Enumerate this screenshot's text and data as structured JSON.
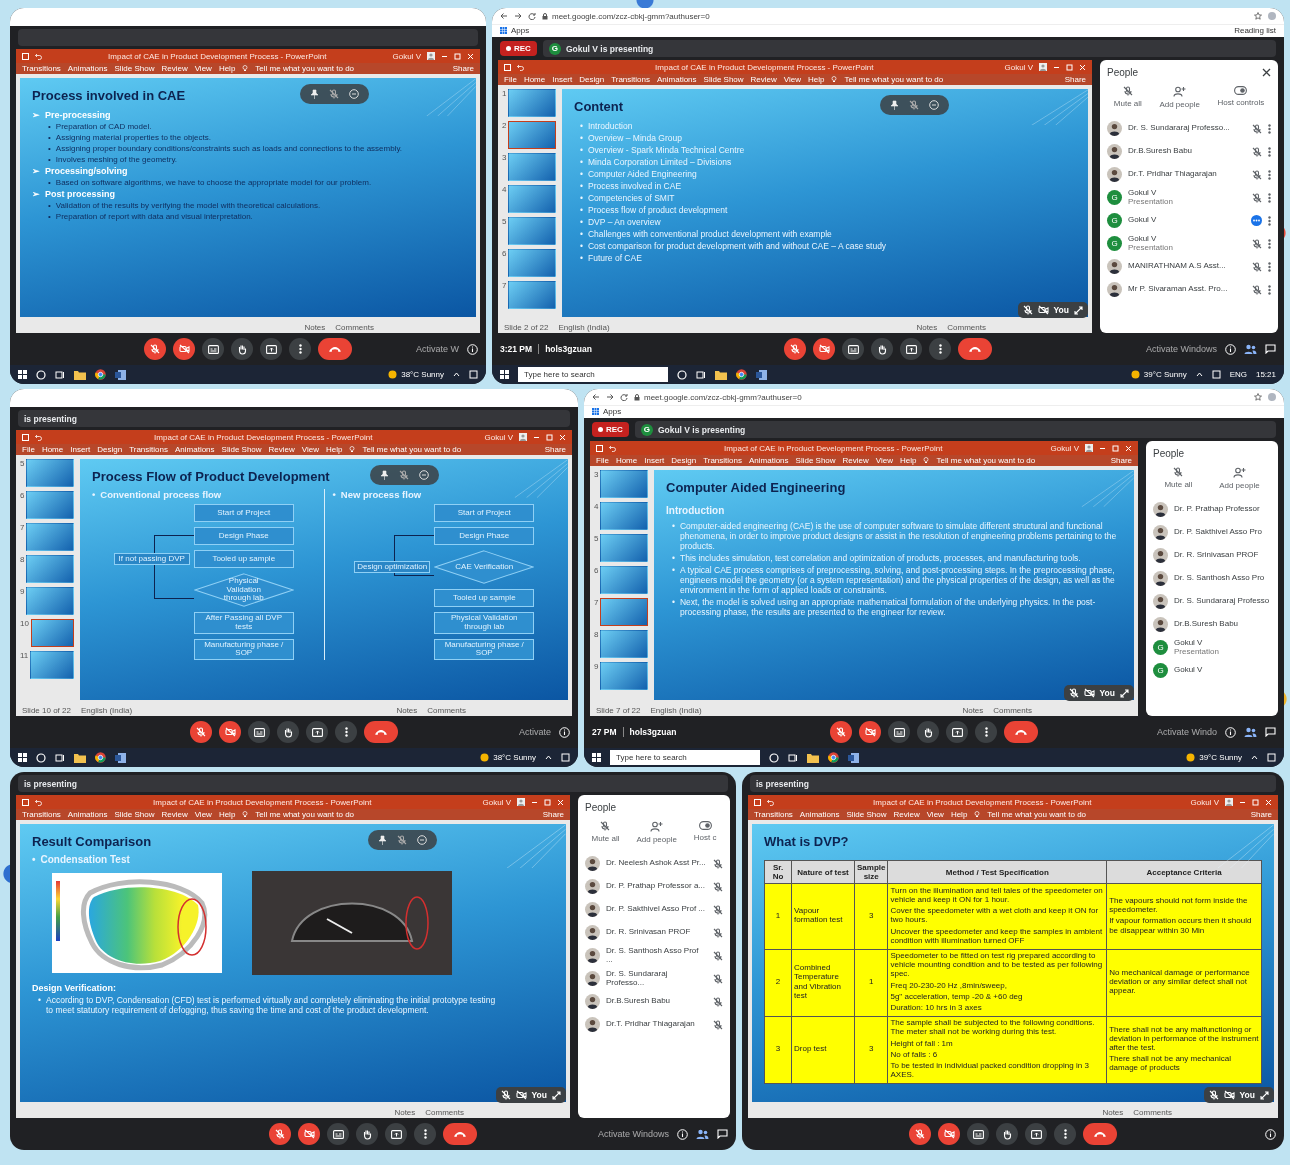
{
  "rows": [
    {
      "panels": [
        {
          "browser": {
            "kind": "blank"
          },
          "ppt": {
            "title": "Impact of CAE in Product Development Process - PowerPoint",
            "user": "Gokul V",
            "tabs": [
              "Transitions",
              "Animations",
              "Slide Show",
              "Review",
              "View",
              "Help"
            ],
            "tell_me": "Tell me what you want to do",
            "share": "Share",
            "status_right": [
              "Notes",
              "Comments"
            ]
          },
          "slide": {
            "kind": "bullets",
            "marker": "➢",
            "sub_marker": "•",
            "title": "Process involved in CAE",
            "items": [
              {
                "text": "Pre-processing",
                "children": [
                  {
                    "text": "Preparation of CAD model."
                  },
                  {
                    "text": "Assigning material properties to the objects."
                  },
                  {
                    "text": "Assigning proper boundary conditions/constraints such as loads and connections to the assembly."
                  },
                  {
                    "text": "Involves meshing of the geometry."
                  }
                ]
              },
              {
                "text": "Processing/solving",
                "children": [
                  {
                    "text": "Based on software algorithms, we have to choose the appropriate model for our problem."
                  }
                ]
              },
              {
                "text": "Post processing",
                "children": [
                  {
                    "text": "Validation of the results by verifying the model with theoretical calculations."
                  },
                  {
                    "text": "Preparation of report with data and visual interpretation."
                  }
                ]
              }
            ]
          },
          "presenter_pill": true,
          "controls": {
            "mic_on": false,
            "camera_on": false
          },
          "activate": "Activate W",
          "taskbar": {
            "weather": "38°C Sunny"
          }
        },
        {
          "browser": {
            "kind": "full",
            "url": "meet.google.com/zcz-cbkj-gmm?authuser=0",
            "apps": "Apps",
            "reading_list": "Reading list"
          },
          "rec": "REC",
          "presenter_initial": "G",
          "presenting": "Gokul V is presenting",
          "ppt": {
            "title": "Impact of CAE in Product Development Process - PowerPoint",
            "user": "Gokul V",
            "tabs": [
              "File",
              "Home",
              "Insert",
              "Design",
              "Transitions",
              "Animations",
              "Slide Show",
              "Review",
              "View",
              "Help"
            ],
            "tell_me": "Tell me what you want to do",
            "share": "Share",
            "thumbs": [
              {
                "number": "1",
                "selected": false
              },
              {
                "number": "2",
                "selected": true
              },
              {
                "number": "3",
                "selected": false
              },
              {
                "number": "4",
                "selected": false
              },
              {
                "number": "5",
                "selected": false
              },
              {
                "number": "6",
                "selected": false
              },
              {
                "number": "7",
                "selected": false
              }
            ],
            "status_left": [
              "Slide 2 of 22",
              "English (India)"
            ],
            "status_right": [
              "Notes",
              "Comments"
            ]
          },
          "slide": {
            "kind": "bullets",
            "marker": "•",
            "title": "Content",
            "items": [
              {
                "text": "Introduction"
              },
              {
                "text": "Overview – Minda Group"
              },
              {
                "text": "Overview - Spark Minda Technical Centre"
              },
              {
                "text": "Minda Corporation Limited – Divisions"
              },
              {
                "text": "Computer Aided Engineering"
              },
              {
                "text": "Process involved in CAE"
              },
              {
                "text": "Competencies of SMIT"
              },
              {
                "text": "Process flow of product development"
              },
              {
                "text": "DVP – An overview"
              },
              {
                "text": "Challenges with conventional product development with example"
              },
              {
                "text": "Cost comparison for product development with and without CAE – A case study"
              },
              {
                "text": "Future of CAE"
              }
            ]
          },
          "presenter_pill": true,
          "self_view": {
            "label": "You"
          },
          "people": {
            "title": "People",
            "closable": true,
            "menu": true,
            "actions": [
              {
                "kind": "mute",
                "label": "Mute all"
              },
              {
                "kind": "add",
                "label": "Add people"
              },
              {
                "kind": "host",
                "label": "Host controls"
              }
            ],
            "items": [
              {
                "kind": "photo",
                "name": "Dr. S. Sundararaj Professo...",
                "muted": true,
                "speaking": false
              },
              {
                "kind": "photo",
                "name": "Dr.B.Suresh Babu",
                "muted": true,
                "speaking": false
              },
              {
                "kind": "photo",
                "name": "Dr.T. Pridhar Thiagarajan",
                "muted": true,
                "speaking": false
              },
              {
                "kind": "letter",
                "initial": "G",
                "name": "Gokul V",
                "note": "Presentation",
                "muted": true,
                "speaking": false
              },
              {
                "kind": "letter",
                "initial": "G",
                "name": "Gokul V",
                "muted": false,
                "speaking": true
              },
              {
                "kind": "letter",
                "initial": "G",
                "name": "Gokul V",
                "note": "Presentation",
                "muted": true,
                "speaking": false
              },
              {
                "kind": "photo",
                "name": "MANIRATHNAM A.S Asst...",
                "muted": true,
                "speaking": false
              },
              {
                "kind": "photo",
                "name": "Mr P. Sivaraman Asst. Pro...",
                "muted": true,
                "speaking": false
              }
            ]
          },
          "clock": "3:21 PM",
          "code": "hols3gzuan",
          "controls": {
            "mic_on": false,
            "camera_on": false
          },
          "activate": "Activate Windows",
          "taskbar": {
            "placeholder": "Type here to search",
            "weather": "39°C Sunny",
            "lang": "ENG",
            "time": "15:21"
          }
        }
      ]
    },
    {
      "panels": [
        {
          "browser": {
            "kind": "blank"
          },
          "presenting": "is presenting",
          "ppt": {
            "title": "Impact of CAE in Product Development Process - PowerPoint",
            "user": "Gokul V",
            "tabs": [
              "File",
              "Home",
              "Insert",
              "Design",
              "Transitions",
              "Animations",
              "Slide Show",
              "Review",
              "View",
              "Help"
            ],
            "tell_me": "Tell me what you want to do",
            "share": "Share",
            "thumbs": [
              {
                "number": "5",
                "selected": false
              },
              {
                "number": "6",
                "selected": false
              },
              {
                "number": "7",
                "selected": false
              },
              {
                "number": "8",
                "selected": false
              },
              {
                "number": "9",
                "selected": false
              },
              {
                "number": "10",
                "selected": true
              },
              {
                "number": "11",
                "selected": false
              }
            ],
            "status_left": [
              "Slide 10 of 22",
              "English (India)"
            ],
            "status_right": [
              "Notes",
              "Comments"
            ]
          },
          "slide": {
            "kind": "flow",
            "marker": "•",
            "title": "Process Flow of Product Development",
            "columns": [
              {
                "heading": "Conventional process flow",
                "side": "If not passing DVP",
                "nodes": [
                  {
                    "kind": "box",
                    "text": "Start of Project"
                  },
                  {
                    "kind": "box",
                    "text": "Design Phase"
                  },
                  {
                    "kind": "box",
                    "text": "Tooled up sample"
                  },
                  {
                    "kind": "decision",
                    "text": "Physical Validation through lab"
                  },
                  {
                    "kind": "box",
                    "text": "After Passing all DVP tests"
                  },
                  {
                    "kind": "box",
                    "text": "Manufacturing phase / SOP"
                  }
                ]
              },
              {
                "heading": "New process flow",
                "side": "Design optimization",
                "nodes": [
                  {
                    "kind": "box",
                    "text": "Start of Project"
                  },
                  {
                    "kind": "box",
                    "text": "Design Phase"
                  },
                  {
                    "kind": "decision",
                    "text": "CAE Verification"
                  },
                  {
                    "kind": "box",
                    "text": "Tooled up sample"
                  },
                  {
                    "kind": "box",
                    "text": "Physical Validation through lab"
                  },
                  {
                    "kind": "box",
                    "text": "Manufacturing phase / SOP"
                  }
                ]
              }
            ]
          },
          "presenter_pill": true,
          "controls": {
            "mic_on": false,
            "camera_on": false
          },
          "activate": "Activate",
          "taskbar": {
            "weather": "38°C Sunny"
          }
        },
        {
          "browser": {
            "kind": "full",
            "url": "meet.google.com/zcz-cbkj-gmm?authuser=0",
            "apps": "Apps"
          },
          "rec": "REC",
          "presenter_initial": "G",
          "presenting": "Gokul V is presenting",
          "ppt": {
            "title": "Impact of CAE in Product Development Process - PowerPoint",
            "user": "Gokul V",
            "tabs": [
              "File",
              "Home",
              "Insert",
              "Design",
              "Transitions",
              "Animations",
              "Slide Show",
              "Review",
              "View",
              "Help"
            ],
            "tell_me": "Tell me what you want to do",
            "share": "Share",
            "thumbs": [
              {
                "number": "3",
                "selected": false
              },
              {
                "number": "4",
                "selected": false
              },
              {
                "number": "5",
                "selected": false
              },
              {
                "number": "6",
                "selected": false
              },
              {
                "number": "7",
                "selected": true
              },
              {
                "number": "8",
                "selected": false
              },
              {
                "number": "9",
                "selected": false
              }
            ],
            "status_left": [
              "Slide 7 of 22",
              "English (India)"
            ],
            "status_right": [
              "Notes",
              "Comments"
            ]
          },
          "slide": {
            "kind": "bullets",
            "marker": "•",
            "title": "Computer Aided Engineering",
            "subtitle": "Introduction",
            "items": [
              {
                "text": "Computer-aided engineering (CAE) is the use of computer software to simulate different structural and functional phenomena, in order to improve product designs or assist in the resolution of engineering problems pertaining to the products."
              },
              {
                "text": "This includes simulation, test correlation and optimization of products, processes, and manufacturing tools."
              },
              {
                "text": "A typical CAE process comprises of preprocessing, solving, and post-processing steps. In the preprocessing phase, engineers model the geometry (or a system representation) and the physical properties of the design, as well as the environment in the form of applied loads or constraints."
              },
              {
                "text": "Next, the model is solved using an appropriate mathematical formulation of the underlying physics. In the post-processing phase, the results are presented to the engineer for review."
              }
            ]
          },
          "self_view": {
            "label": "You"
          },
          "people": {
            "title": "People",
            "actions": [
              {
                "kind": "mute",
                "label": "Mute all"
              },
              {
                "kind": "add",
                "label": "Add people"
              }
            ],
            "items": [
              {
                "kind": "photo",
                "name": "Dr. P. Prathap Professor"
              },
              {
                "kind": "photo",
                "name": "Dr. P. Sakthivel Asso Pro"
              },
              {
                "kind": "photo",
                "name": "Dr. R. Srinivasan PROF"
              },
              {
                "kind": "photo",
                "name": "Dr. S. Santhosh Asso Pro"
              },
              {
                "kind": "photo",
                "name": "Dr. S. Sundararaj Professo"
              },
              {
                "kind": "photo",
                "name": "Dr.B.Suresh Babu"
              },
              {
                "kind": "letter",
                "initial": "G",
                "name": "Gokul V",
                "note": "Presentation"
              },
              {
                "kind": "letter",
                "initial": "G",
                "name": "Gokul V"
              }
            ]
          },
          "clock": "27 PM",
          "code": "hols3gzuan",
          "controls": {
            "mic_on": false,
            "camera_on": false
          },
          "activate": "Activate Windo",
          "taskbar": {
            "placeholder": "Type here to search",
            "weather": "39°C Sunny"
          }
        }
      ]
    },
    {
      "panels": [
        {
          "presenting": "is presenting",
          "ppt": {
            "title": "Impact of CAE in Product Development Process - PowerPoint",
            "user": "Gokul V",
            "tabs": [
              "Transitions",
              "Animations",
              "Slide Show",
              "Review",
              "View",
              "Help"
            ],
            "tell_me": "Tell me what you want to do",
            "share": "Share",
            "status_right": [
              "Notes",
              "Comments"
            ]
          },
          "slide": {
            "kind": "result",
            "marker": "•",
            "title": "Result Comparison",
            "subheading": "Condensation Test",
            "verification_title": "Design Verification:",
            "verification_text": "According to DVP, Condensation (CFD) test is performed virtually and completely eliminating the initial prototype testing to meet statutory requirement of defogging, thus saving the time and cost of the product development."
          },
          "presenter_pill": true,
          "self_view": {
            "label": "You"
          },
          "people": {
            "title": "People",
            "actions": [
              {
                "kind": "mute",
                "label": "Mute all"
              },
              {
                "kind": "add",
                "label": "Add people"
              },
              {
                "kind": "host",
                "label": "Host c"
              }
            ],
            "items": [
              {
                "kind": "photo",
                "name": "Dr. Neelesh Ashok Asst Pr...",
                "muted": true,
                "speaking": false
              },
              {
                "kind": "photo",
                "name": "Dr. P. Prathap Professor a...",
                "muted": true,
                "speaking": false
              },
              {
                "kind": "photo",
                "name": "Dr. P. Sakthivel Asso Prof ...",
                "muted": true,
                "speaking": false
              },
              {
                "kind": "photo",
                "name": "Dr. R. Srinivasan PROF",
                "muted": true,
                "speaking": false
              },
              {
                "kind": "photo",
                "name": "Dr. S. Santhosh Asso Prof ...",
                "muted": true,
                "speaking": false
              },
              {
                "kind": "photo",
                "name": "Dr. S. Sundararaj Professo...",
                "muted": true,
                "speaking": false
              },
              {
                "kind": "photo",
                "name": "Dr.B.Suresh Babu",
                "muted": true,
                "speaking": false
              },
              {
                "kind": "photo",
                "name": "Dr.T. Pridhar Thiagarajan",
                "muted": true,
                "speaking": false
              }
            ]
          },
          "controls": {
            "mic_on": false,
            "camera_on": false
          },
          "activate": "Activate Windows"
        },
        {
          "presenting": "is presenting",
          "ppt": {
            "title": "Impact of CAE in Product Development Process - PowerPoint",
            "user": "Gokul V",
            "tabs": [
              "Transitions",
              "Animations",
              "Slide Show",
              "Review",
              "View",
              "Help"
            ],
            "tell_me": "Tell me what you want to do",
            "share": "Share",
            "status_right": [
              "Notes",
              "Comments"
            ]
          },
          "slide": {
            "kind": "table",
            "title": "What is DVP?",
            "columns": [
              "Sr. No",
              "Nature of test",
              "Sample size",
              "Method / Test Specification",
              "Acceptance Criteria"
            ],
            "rows": [
              {
                "cells": [
                  [
                    "1"
                  ],
                  [
                    "Vapour formation test"
                  ],
                  [
                    "3"
                  ],
                  [
                    "Turn on the illumination and tell tales of the speedometer on vehicle and keep it ON for 1 hour.",
                    "Cover the speedometer with a wet cloth and keep it ON for two hours.",
                    "Uncover the speedometer and keep the samples in ambient condition with illumination turned OFF"
                  ],
                  [
                    "The vapours should not form inside the speedometer.",
                    "If vapour formation occurs then it should be disappear within 30 Min"
                  ]
                ]
              },
              {
                "cells": [
                  [
                    "2"
                  ],
                  [
                    "Combined Temperature and Vibration test"
                  ],
                  [
                    "1"
                  ],
                  [
                    "Speedometer to be fitted on test rig prepared according to vehicle mounting condition and to be tested as per following spec.",
                    "Freq 20-230-20 Hz ,8min/sweep,",
                    "5g\" acceleration, temp -20 & +60 deg",
                    "Duration: 10 hrs in 3 axes"
                  ],
                  [
                    "No mechanical damage or performance deviation or any similar defect shall not appear."
                  ]
                ]
              },
              {
                "cells": [
                  [
                    "3"
                  ],
                  [
                    "Drop test"
                  ],
                  [
                    "3"
                  ],
                  [
                    "The sample shall be subjected to the following conditions. The meter shall not be working during this test.",
                    "Height of fall : 1m",
                    "No of falls : 6",
                    "To be tested in individual packed condition dropping in 3 AXES."
                  ],
                  [
                    "There shall not be any malfunctioning or deviation in performance of the instrument after the test.",
                    "There shall not be any mechanical damage of products"
                  ]
                ]
              }
            ]
          },
          "self_view": {
            "label": "You"
          },
          "controls": {
            "mic_on": false,
            "camera_on": false
          }
        }
      ]
    }
  ]
}
